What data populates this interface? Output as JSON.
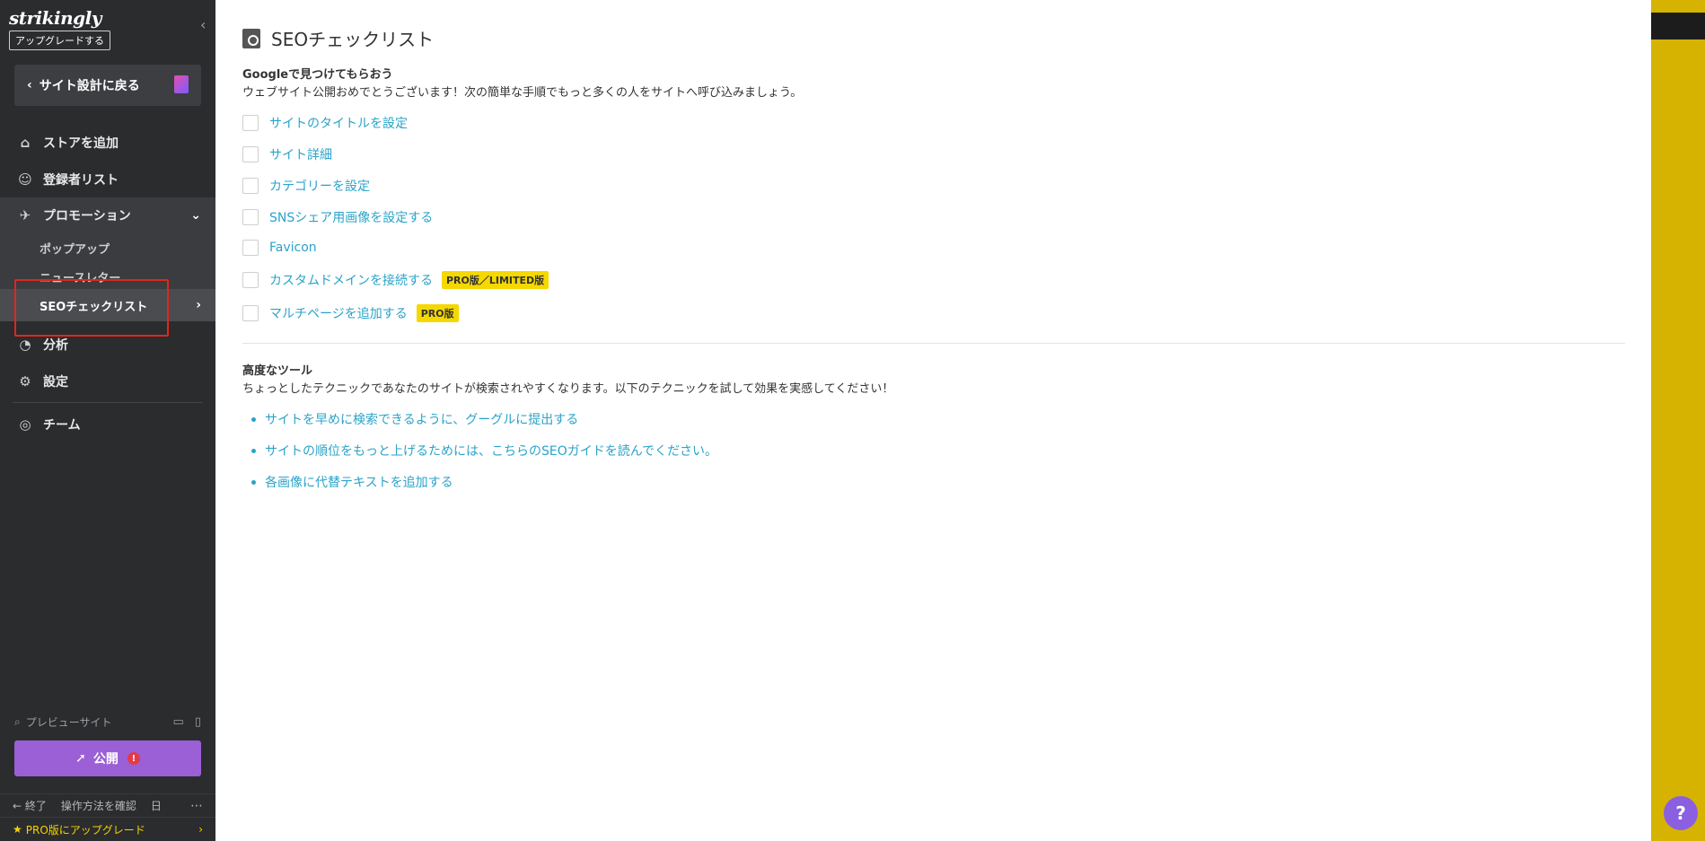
{
  "brand": {
    "logo": "strikingly",
    "upgrade": "アップグレードする"
  },
  "sidebar": {
    "back_label": "サイト設計に戻る",
    "items": [
      {
        "label": "ストアを追加",
        "icon": "store-icon"
      },
      {
        "label": "登録者リスト",
        "icon": "users-icon"
      },
      {
        "label": "プロモーション",
        "icon": "megaphone-icon"
      }
    ],
    "sub_items": [
      {
        "label": "ポップアップ"
      },
      {
        "label": "ニュースレター"
      },
      {
        "label": "SEOチェックリスト"
      }
    ],
    "items2": [
      {
        "label": "分析",
        "icon": "analytics-icon"
      },
      {
        "label": "設定",
        "icon": "gear-icon"
      },
      {
        "label": "チーム",
        "icon": "team-icon"
      }
    ],
    "preview": "プレビューサイト",
    "publish": "公開",
    "footer": {
      "exit": "終了",
      "guide": "操作方法を確認",
      "lang": "日"
    },
    "pro_upgrade": "PRO版にアップグレード"
  },
  "main": {
    "title": "SEOチェックリスト",
    "google": {
      "title": "Googleで見つけてもらおう",
      "desc": "ウェブサイト公開おめでとうございます！次の簡単な手順でもっと多くの人をサイトへ呼び込みましょう。",
      "items": [
        {
          "label": "サイトのタイトルを設定"
        },
        {
          "label": "サイト詳細"
        },
        {
          "label": "カテゴリーを設定"
        },
        {
          "label": "SNSシェア用画像を設定する"
        },
        {
          "label": "Favicon"
        },
        {
          "label": "カスタムドメインを接続する",
          "badge": "PRO版／LIMITED版"
        },
        {
          "label": "マルチページを追加する",
          "badge": "PRO版"
        }
      ]
    },
    "advanced": {
      "title": "高度なツール",
      "desc": "ちょっとしたテクニックであなたのサイトが検索されやすくなります。以下のテクニックを試して効果を実感してください！",
      "links": [
        {
          "label": "サイトを早めに検索できるように、グーグルに提出する"
        },
        {
          "label": "サイトの順位をもっと上げるためには、こちらのSEOガイドを読んでください。"
        },
        {
          "label": "各画像に代替テキストを追加する"
        }
      ]
    }
  },
  "help": "?"
}
